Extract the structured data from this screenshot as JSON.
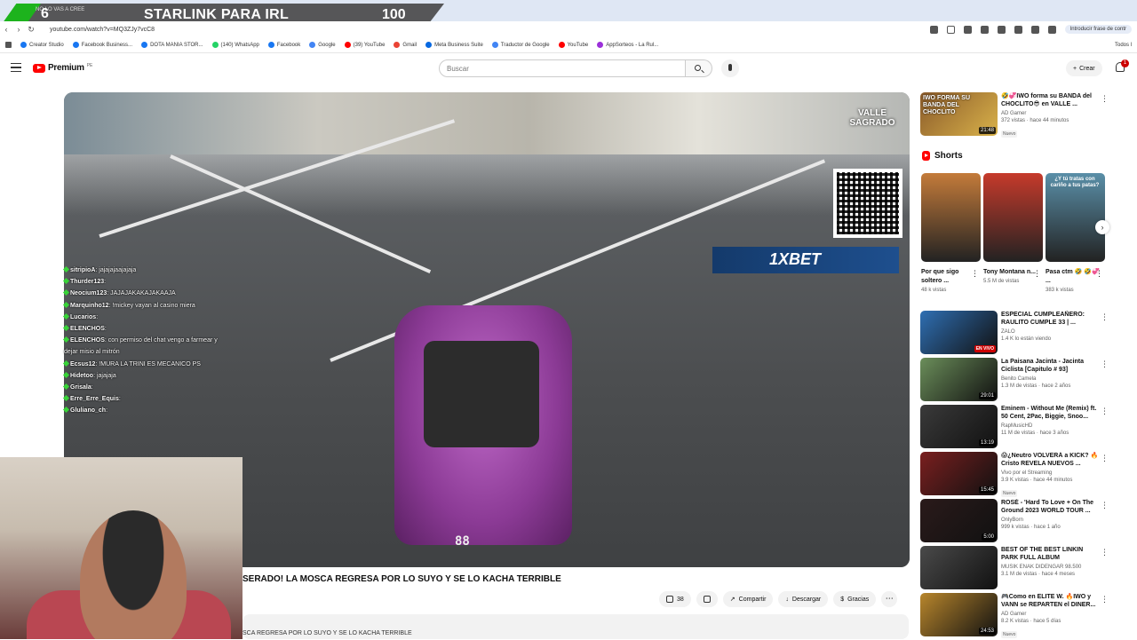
{
  "browser": {
    "url": "youtube.com/watch?v=MQ3ZJy7vcC8",
    "translate_label": "Introducir frase de contr",
    "bookmarks": [
      {
        "label": "Creator Studio",
        "color": "#1877f2"
      },
      {
        "label": "Facebook Business...",
        "color": "#1877f2"
      },
      {
        "label": "DOTA MANIA STOR...",
        "color": "#1877f2"
      },
      {
        "label": "(140) WhatsApp",
        "color": "#25d366"
      },
      {
        "label": "Facebook",
        "color": "#1877f2"
      },
      {
        "label": "Google",
        "color": "#4285f4"
      },
      {
        "label": "(39) YouTube",
        "color": "#ff0000"
      },
      {
        "label": "Gmail",
        "color": "#ea4335"
      },
      {
        "label": "Meta Business Suite",
        "color": "#0668e1"
      },
      {
        "label": "Traductor de Google",
        "color": "#4285f4"
      },
      {
        "label": "YouTube",
        "color": "#ff0000"
      },
      {
        "label": "AppSorteos - La Rul...",
        "color": "#9b30d9"
      }
    ],
    "bookmarks_all": "Todos l"
  },
  "overlay": {
    "tab_text": "NO LO VAS A CREE",
    "left_number": "6",
    "title": "STARLINK PARA IRL",
    "count": "100"
  },
  "header": {
    "logo": "Premium",
    "logo_country": "PE",
    "search_placeholder": "Buscar",
    "create_label": "Crear",
    "notifications": "1"
  },
  "video": {
    "title": "SERADO! LA MOSCA REGRESA POR LO SUYO Y SE LO KACHA TERRIBLE",
    "logo_text": "VALLE SAGRADO",
    "banner": "1XBET",
    "speed": "88",
    "likes": "38",
    "share": "Compartir",
    "download": "Descargar",
    "thanks": "Gracias",
    "description": "SCA REGRESA POR LO SUYO Y SE LO KACHA TERRIBLE"
  },
  "chat": [
    {
      "user": "sitripioA",
      "msg": ": jajajajaajajaja"
    },
    {
      "user": "Thurder123",
      "msg": ": "
    },
    {
      "user": "Neocium123",
      "msg": ": JAJAJAKAKAJAKAAJA"
    },
    {
      "user": "Marquinho12",
      "msg": ": !mickey vayan al casino miera"
    },
    {
      "user": "Lucarios",
      "msg": ": "
    },
    {
      "user": "ELENCHOS",
      "msg": ": "
    },
    {
      "user": "ELENCHOS",
      "msg": ": con permiso del chat vengo a farmear y"
    },
    {
      "user": "",
      "msg": "dejar misio al mitrón"
    },
    {
      "user": "Ecsus12",
      "msg": ": !MURA LA TRINI ES MECANICO PS"
    },
    {
      "user": "Hidetoo",
      "msg": ": jajajaja"
    },
    {
      "user": "Grisala",
      "msg": ": "
    },
    {
      "user": "Erre_Erre_Equis",
      "msg": ": "
    },
    {
      "user": "Gluliano_ch",
      "msg": ": "
    }
  ],
  "sidebar": {
    "top_video": {
      "title": "🤣💞IWO forma su BANDA del CHOCLITO😎 en VALLE ...",
      "channel": "AD Gamer",
      "stats": "372 vistas · hace 44 minutos",
      "badge": "Nuevo",
      "duration": "21:48",
      "thumb_text": "IWO FORMA SU BANDA DEL CHOCLITO"
    },
    "shorts_label": "Shorts",
    "shorts": [
      {
        "title": "Por que sigo soltero ...",
        "views": "48 k vistas",
        "color": "#c47b3a"
      },
      {
        "title": "Tony Montana n...",
        "views": "5.5 M de vistas",
        "color": "#c63a2b"
      },
      {
        "title": "Pasa ctm 🤣 🤣💞 ...",
        "views": "383 k vistas",
        "color": "#5a8fa8",
        "thumb_text": "¿Y tú tratas con cariño a tus patas?"
      }
    ],
    "videos": [
      {
        "title": "ESPECIAL CUMPLEAÑERO: RAULITO CUMPLE 33 | ...",
        "channel": "ZALO",
        "stats": "1.4 K lo están viendo",
        "badge": "",
        "duration": "EN VIVO",
        "live": true,
        "color": "#2f6fb3"
      },
      {
        "title": "La Paisana Jacinta - Jacinta Ciclista [Capitulo # 93]",
        "channel": "Benito Camela",
        "stats": "1.3 M de vistas · hace 2 años",
        "badge": "",
        "duration": "29:01",
        "live": false,
        "color": "#6b8e5a"
      },
      {
        "title": "Eminem - Without Me (Remix) ft. 50 Cent, 2Pac, Biggie, Snoo...",
        "channel": "RapMusicHD",
        "stats": "11 M de vistas · hace 3 años",
        "badge": "",
        "duration": "13:19",
        "live": false,
        "color": "#3a3a3a"
      },
      {
        "title": "😱¿Neutro VOLVERÁ a KICK? 🔥 Cristo REVELA NUEVOS ...",
        "channel": "Vivo por el Streaming",
        "stats": "3.9 K vistas · hace 44 minutos",
        "badge": "Nuevo",
        "duration": "15:45",
        "live": false,
        "color": "#7a1f1f"
      },
      {
        "title": "ROSÉ - 'Hard To Love + On The Ground 2023 WORLD TOUR ...",
        "channel": "OnlyBorn",
        "stats": "999 k vistas · hace 1 año",
        "badge": "",
        "duration": "5:00",
        "live": false,
        "color": "#2a1a1a"
      },
      {
        "title": "BEST OF THE BEST LINKIN PARK FULL ALBUM",
        "channel": "MUSIK ENAK DIDENGAR 98.500",
        "stats": "3.1 M de vistas · hace 4 meses",
        "badge": "",
        "duration": "",
        "live": false,
        "color": "#4a4a4a"
      },
      {
        "title": "🎮Como en ELITE W. 🔥IWO y VANN se REPARTEN el DINER...",
        "channel": "AD Gamer",
        "stats": "8.2 K vistas · hace 5 días",
        "badge": "Nuevo",
        "duration": "24:53",
        "live": false,
        "color": "#b8862c"
      }
    ]
  }
}
